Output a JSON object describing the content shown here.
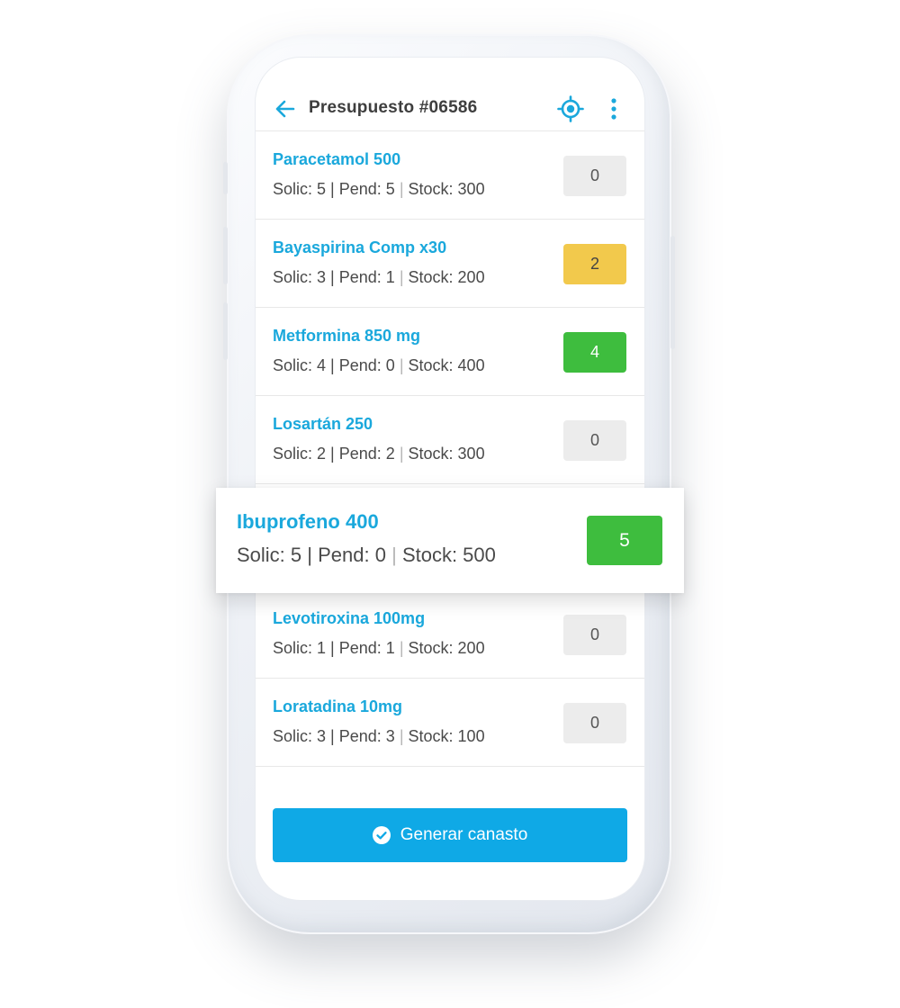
{
  "header": {
    "title": "Presupuesto #06586",
    "back_icon": "arrow-left-icon",
    "locate_icon": "target-icon",
    "menu_icon": "more-vertical-icon"
  },
  "colors": {
    "accent": "#0fa9e6",
    "link": "#1aa8dc",
    "qty_empty": "#ececec",
    "qty_partial": "#f2c94c",
    "qty_complete": "#3ebd3e"
  },
  "items": [
    {
      "name": "Paracetamol 500",
      "solic": "Solic: 5",
      "pend": "Pend: 5",
      "stock": "Stock: 300",
      "qty": "0",
      "status": "gray"
    },
    {
      "name": "Bayaspirina Comp x30",
      "solic": "Solic: 3",
      "pend": "Pend: 1",
      "stock": "Stock: 200",
      "qty": "2",
      "status": "yellow"
    },
    {
      "name": "Metformina 850 mg",
      "solic": "Solic: 4",
      "pend": "Pend: 0",
      "stock": "Stock: 400",
      "qty": "4",
      "status": "green"
    },
    {
      "name": "Losartán 250",
      "solic": "Solic: 2",
      "pend": "Pend: 2",
      "stock": "Stock: 300",
      "qty": "0",
      "status": "gray"
    },
    {
      "name": "Ibuprofeno 400",
      "solic": "Solic: 5",
      "pend": "Pend: 0",
      "stock": "Stock: 500",
      "qty": "5",
      "status": "green"
    },
    {
      "name": "Levotiroxina 100mg",
      "solic": "Solic: 1",
      "pend": "Pend: 1",
      "stock": "Stock: 200",
      "qty": "0",
      "status": "gray"
    },
    {
      "name": "Loratadina 10mg",
      "solic": "Solic: 3",
      "pend": "Pend: 3",
      "stock": "Stock: 100",
      "qty": "0",
      "status": "gray"
    }
  ],
  "footer": {
    "button_label": "Generar canasto",
    "button_icon": "check-circle-icon"
  },
  "separators": {
    "bar": "|"
  }
}
